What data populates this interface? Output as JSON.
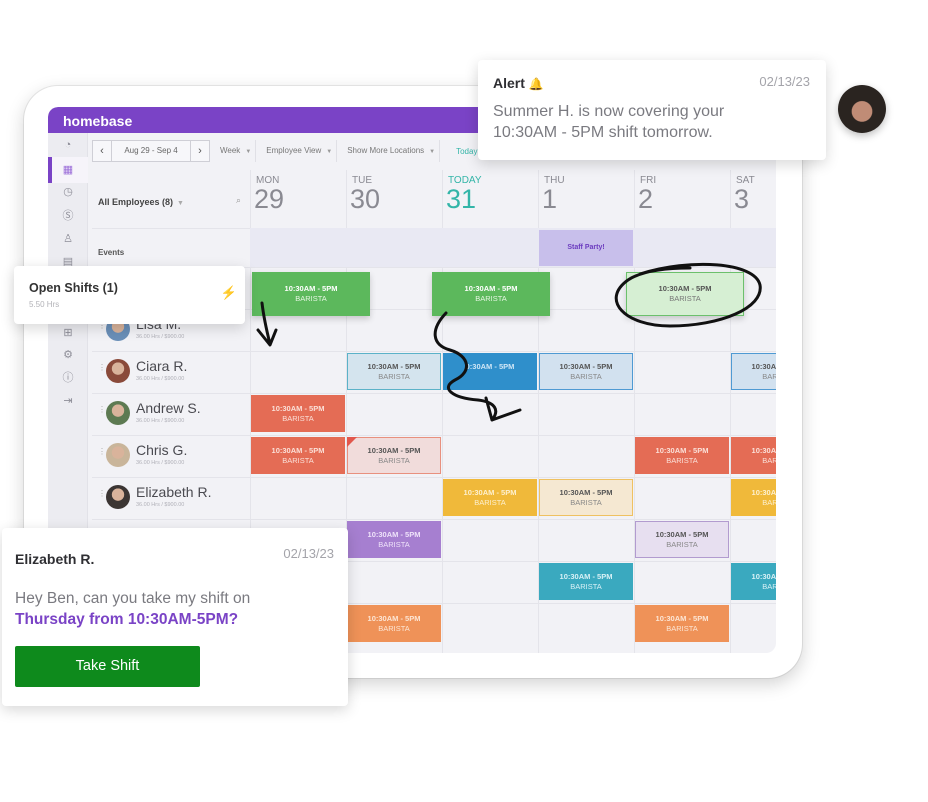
{
  "app": {
    "brand": "homebase",
    "brand_color": "#7a43c6"
  },
  "toolbar": {
    "prev_icon": "chevron-left-icon",
    "date_range": "Aug 29 - Sep 4",
    "next_icon": "chevron-right-icon",
    "view_period": "Week",
    "view_mode": "Employee View",
    "locations": "Show More Locations",
    "today_label": "Today"
  },
  "sidebar_icons": [
    "dashboard-icon",
    "calendar-icon",
    "clock-icon",
    "dollar-icon",
    "person-icon",
    "document-icon",
    "add-icon",
    "gear-icon",
    "help-icon",
    "collapse-icon"
  ],
  "employees_filter": "All Employees (8)",
  "events_label": "Events",
  "days": [
    {
      "dow": "MON",
      "num": "29",
      "today": false
    },
    {
      "dow": "TUE",
      "num": "30",
      "today": false
    },
    {
      "dow": "TODAY",
      "num": "31",
      "today": true
    },
    {
      "dow": "THU",
      "num": "1",
      "today": false
    },
    {
      "dow": "FRI",
      "num": "2",
      "today": false
    },
    {
      "dow": "SAT",
      "num": "3",
      "today": false
    }
  ],
  "event": {
    "label": "Staff Party!",
    "day": 3
  },
  "open_shifts": {
    "title": "Open Shifts (1)",
    "hours": "5.50 Hrs"
  },
  "employees": [
    {
      "name": "Lisa M.",
      "meta": "36.00 Hrs / $900.00"
    },
    {
      "name": "Ciara R.",
      "meta": "36.00 Hrs / $900.00"
    },
    {
      "name": "Andrew S.",
      "meta": "36.00 Hrs / $900.00"
    },
    {
      "name": "Chris G.",
      "meta": "36.00 Hrs / $900.00"
    },
    {
      "name": "Elizabeth R.",
      "meta": "36.00 Hrs / $900.00"
    }
  ],
  "shift_time": "10:30AM - 5PM",
  "shift_role": "BARISTA",
  "shift_time_partial": "0:30AM - 5PM",
  "alert": {
    "title": "Alert",
    "date": "02/13/23",
    "body": "Summer H. is now covering your 10:30AM - 5PM shift tomorrow."
  },
  "message": {
    "sender": "Elizabeth R.",
    "date": "02/13/23",
    "body": "Hey Ben, can you take my shift on",
    "highlight": "Thursday from 10:30AM-5PM?",
    "button": "Take Shift"
  }
}
